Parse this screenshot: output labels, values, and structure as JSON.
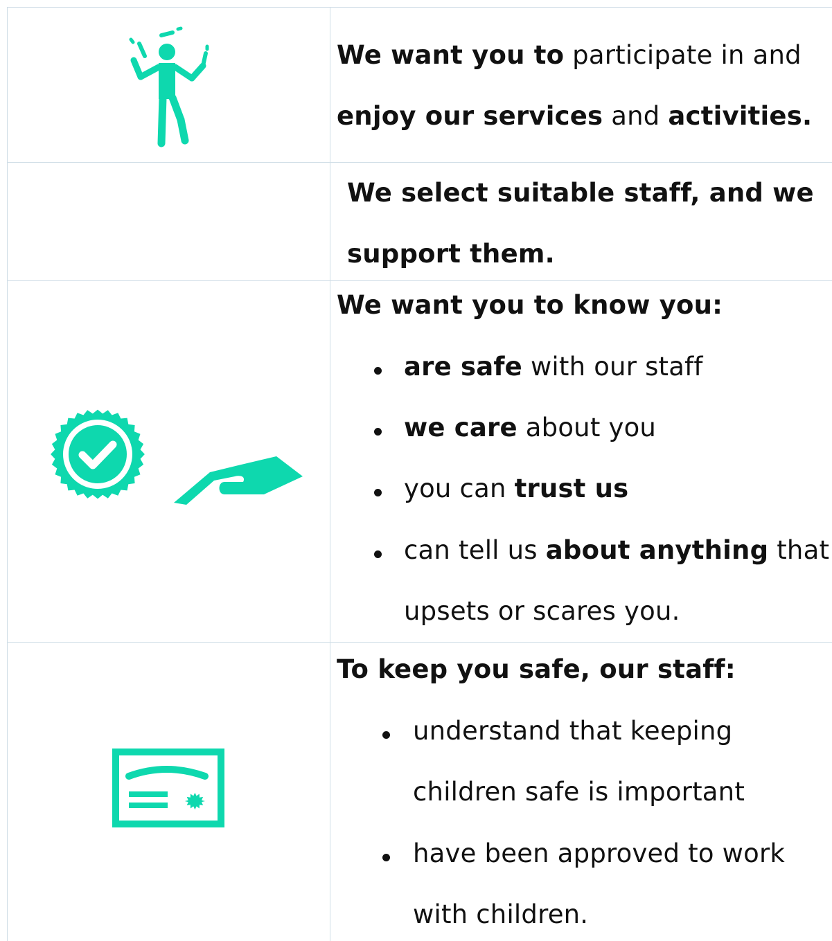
{
  "colors": {
    "accent": "#0ed8ae",
    "border": "#cfdde6"
  },
  "rows": [
    {
      "icon": "juggler-icon",
      "line1": {
        "b1": "We want you to",
        "t1": " participate in and"
      },
      "line2": {
        "b1": "enjoy our services",
        "t1": " and ",
        "b2": "activities."
      }
    },
    {
      "icon": "",
      "line1": "We select suitable staff, and we",
      "line2": "support them."
    },
    {
      "icon": "badge-hand-icon",
      "heading": "We want you to know you:",
      "bullets": [
        {
          "b": "are safe",
          "t": " with our staff"
        },
        {
          "b": "we care",
          "t": " about you"
        },
        {
          "t": "you can ",
          "b": "trust us"
        },
        {
          "t1": "can tell us ",
          "b": "about anything",
          "t2": " that",
          "cont": "upsets or scares you."
        }
      ]
    },
    {
      "icon": "certificate-icon",
      "heading": "To keep you safe, our staff:",
      "bullets": [
        {
          "l1": "understand that keeping",
          "l2": "children safe is important"
        },
        {
          "l1": "have been approved to work",
          "l2": "with children."
        }
      ]
    }
  ]
}
